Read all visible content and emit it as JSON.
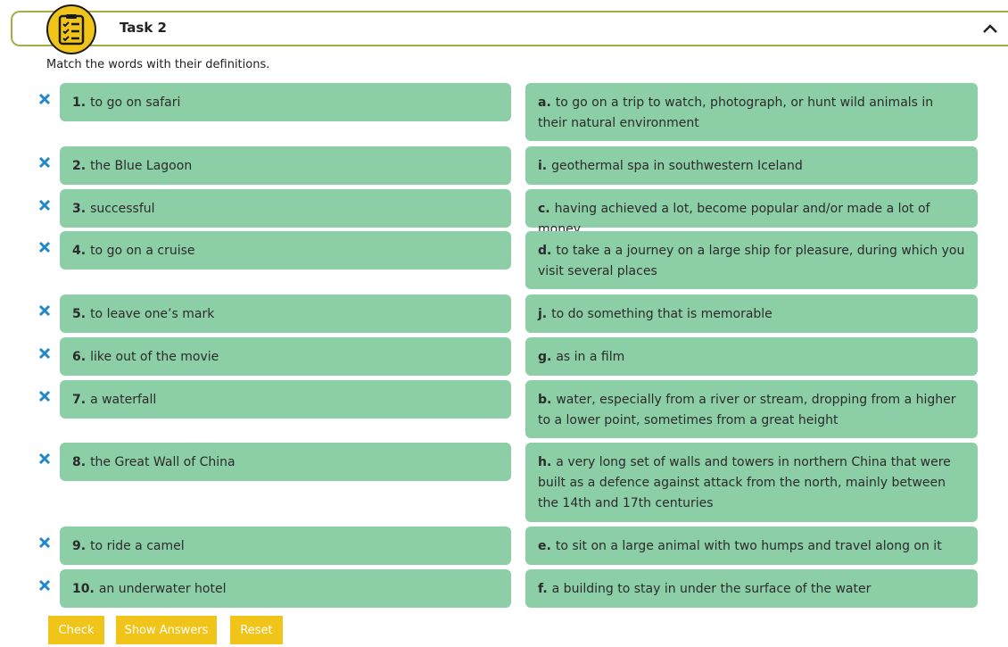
{
  "task": {
    "title": "Task 2",
    "instructions": "Match the words with their definitions."
  },
  "colors": {
    "card": "#8ccfa6",
    "accent_yellow": "#f0c419",
    "wrong_mark": "#1e88c8",
    "header_border": "#a6ad46"
  },
  "icons": [
    "checklist-icon",
    "chevron-up-icon",
    "wrong-x-icon"
  ],
  "pairs": [
    {
      "left_num": "1.",
      "left_text": "to go on safari",
      "right_letter": "a.",
      "right_text": "to go on a  trip to watch, photograph, or hunt wild animals in their natural environment"
    },
    {
      "left_num": "2.",
      "left_text": "the Blue Lagoon",
      "right_letter": "i.",
      "right_text": "geothermal spa in southwestern Iceland"
    },
    {
      "left_num": "3.",
      "left_text": "successful",
      "right_letter": "c.",
      "right_text": "having achieved a lot, become popular and/or made a lot of money"
    },
    {
      "left_num": "4.",
      "left_text": "to go on a cruise",
      "right_letter": "d.",
      "right_text": "to take  a a journey on a large ship for pleasure, during which you visit several places"
    },
    {
      "left_num": "5.",
      "left_text": "to leave one’s mark",
      "right_letter": "j.",
      "right_text": "to do something that is memorable"
    },
    {
      "left_num": "6.",
      "left_text": "like out of the movie",
      "right_letter": "g.",
      "right_text": "as in a film"
    },
    {
      "left_num": "7.",
      "left_text": "a waterfall",
      "right_letter": "b.",
      "right_text": "water, especially from a river or stream, dropping from a higher to a lower point, sometimes from a great height"
    },
    {
      "left_num": "8.",
      "left_text": "the Great Wall of China",
      "right_letter": "h.",
      "right_text": "a very long set of walls and towers in northern China that were built as a defence against attack from the north, mainly between the 14th and 17th centuries"
    },
    {
      "left_num": "9.",
      "left_text": "to ride a camel",
      "right_letter": "e.",
      "right_text": "to sit on a  large animal with two humps and travel along on it"
    },
    {
      "left_num": "10.",
      "left_text": "an underwater hotel",
      "right_letter": "f.",
      "right_text": "a building to stay in under the surface of the water"
    }
  ],
  "buttons": {
    "check": "Check",
    "show_answers": "Show Answers",
    "reset": "Reset"
  }
}
